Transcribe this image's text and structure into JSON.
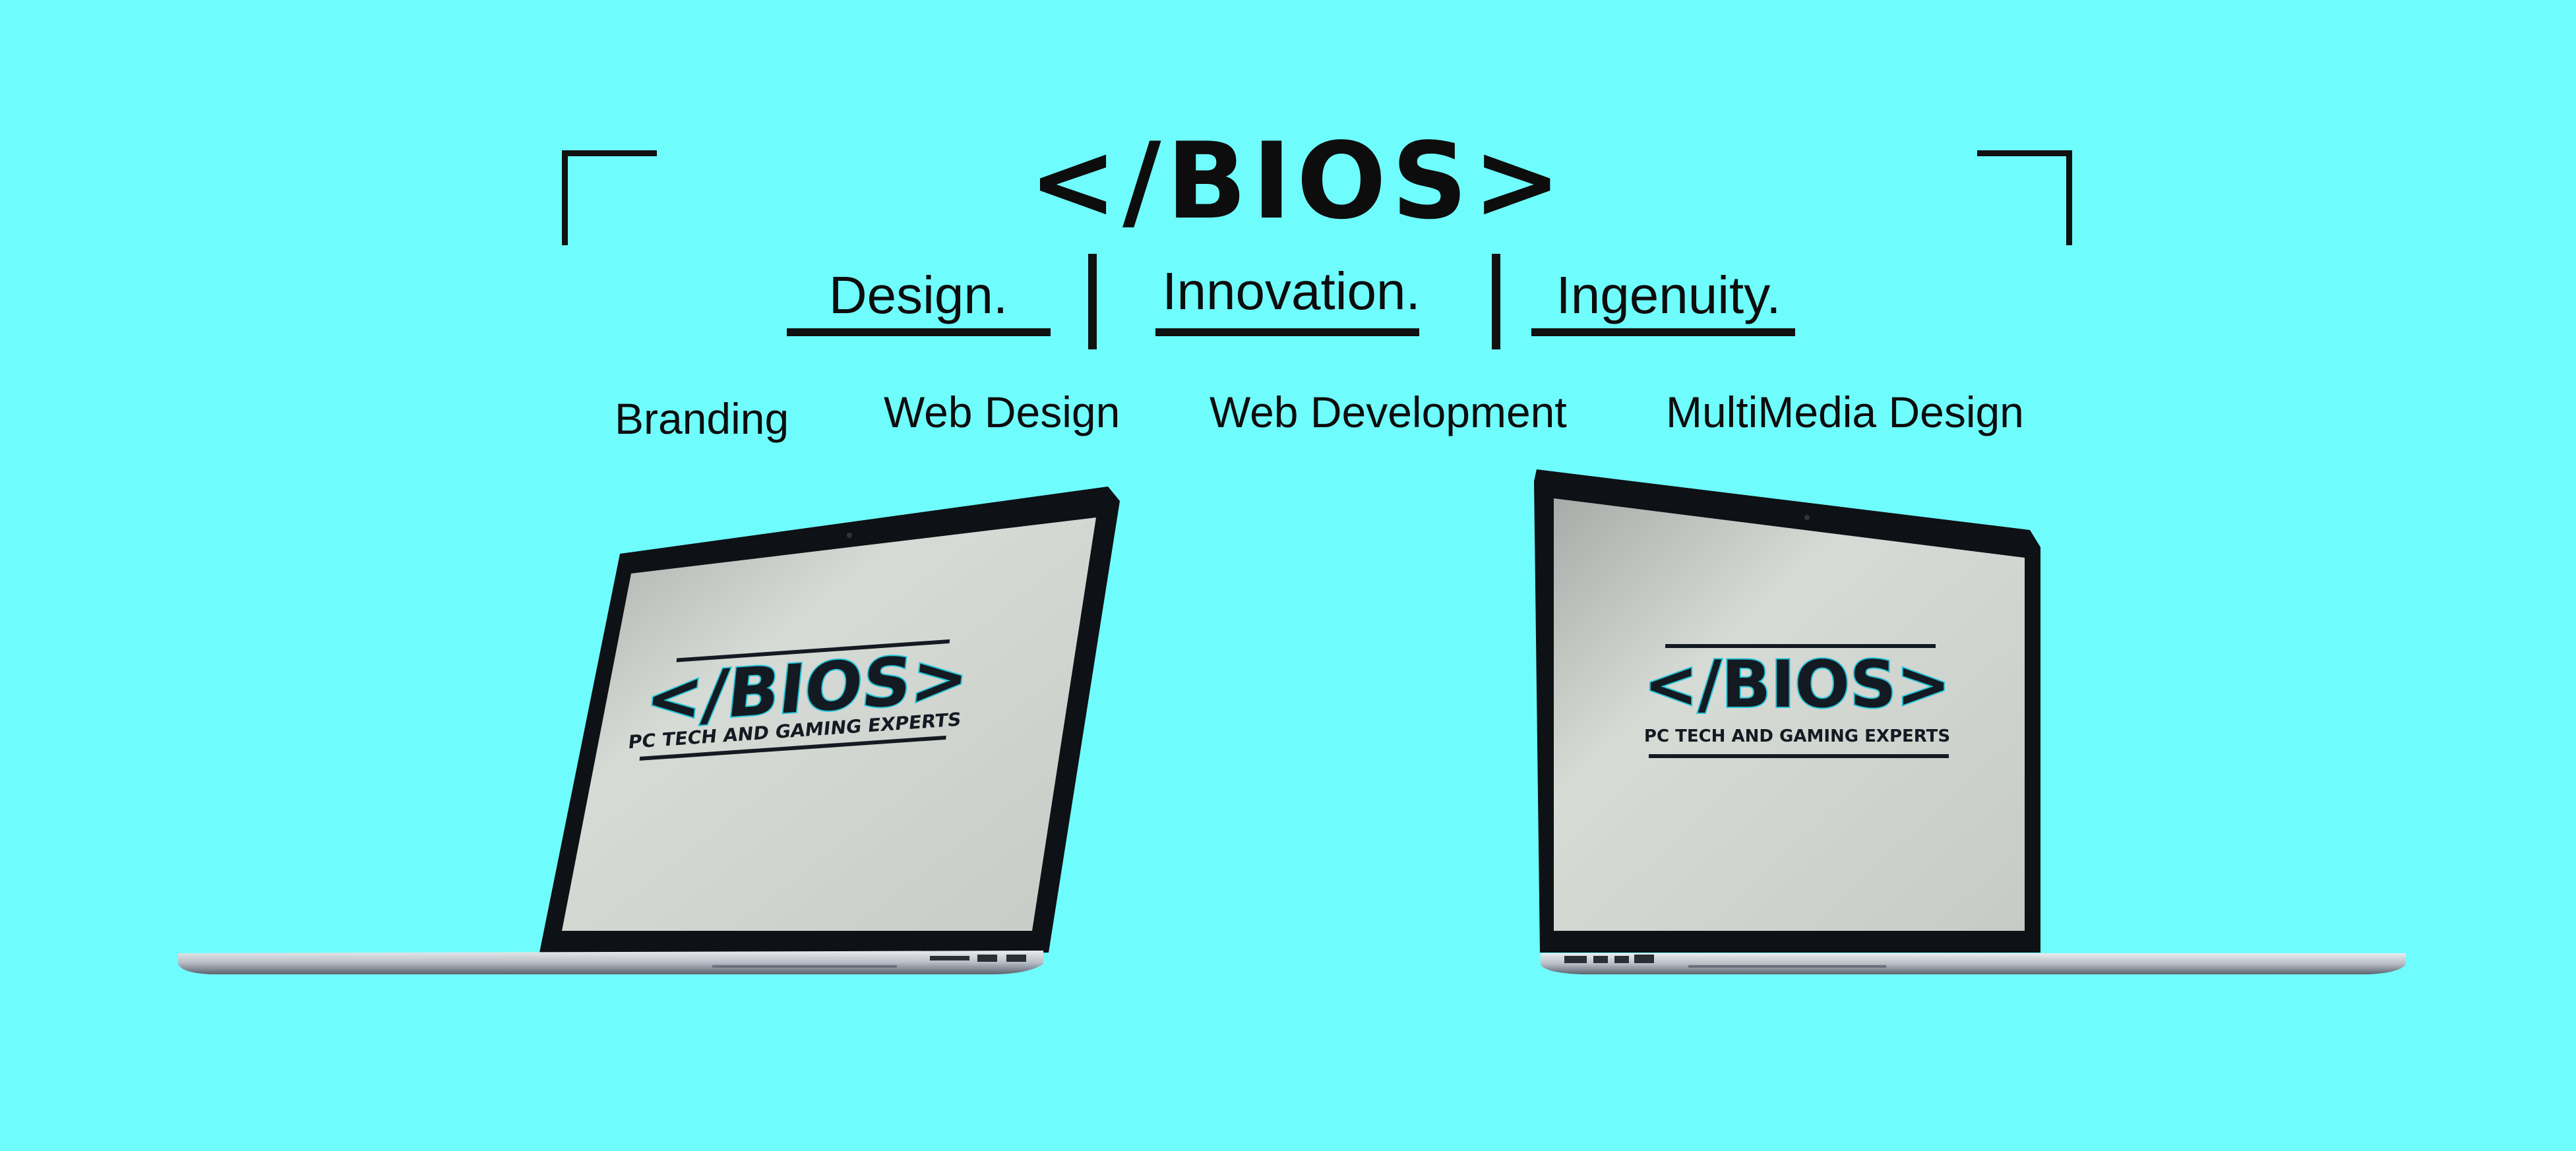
{
  "brand": {
    "title": "</BIOS>"
  },
  "taglines": [
    "Design.",
    "Innovation.",
    "Ingenuity."
  ],
  "services": [
    "Branding",
    "Web Design",
    "Web Development",
    "MultiMedia Design"
  ],
  "screen_logo": {
    "title": "</BIOS>",
    "subtitle": "PC TECH AND GAMING EXPERTS"
  },
  "colors": {
    "background": "#6ffcfd",
    "ink": "#111111",
    "logo_accent": "#27c6d8"
  }
}
